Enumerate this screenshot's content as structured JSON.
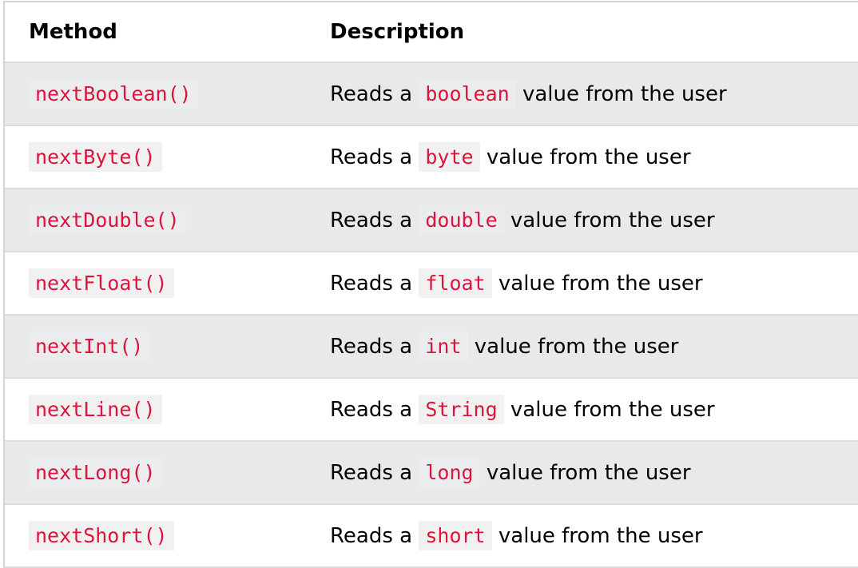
{
  "headers": {
    "method": "Method",
    "description": "Description"
  },
  "desc_prefix": "Reads a",
  "desc_suffix": "value from the user",
  "rows": [
    {
      "method": "nextBoolean()",
      "type": "boolean"
    },
    {
      "method": "nextByte()",
      "type": "byte"
    },
    {
      "method": "nextDouble()",
      "type": "double"
    },
    {
      "method": "nextFloat()",
      "type": "float"
    },
    {
      "method": "nextInt()",
      "type": "int"
    },
    {
      "method": "nextLine()",
      "type": "String"
    },
    {
      "method": "nextLong()",
      "type": "long"
    },
    {
      "method": "nextShort()",
      "type": "short"
    }
  ],
  "colors": {
    "code": "#dc143c",
    "alt_row": "#e7e9eb"
  }
}
